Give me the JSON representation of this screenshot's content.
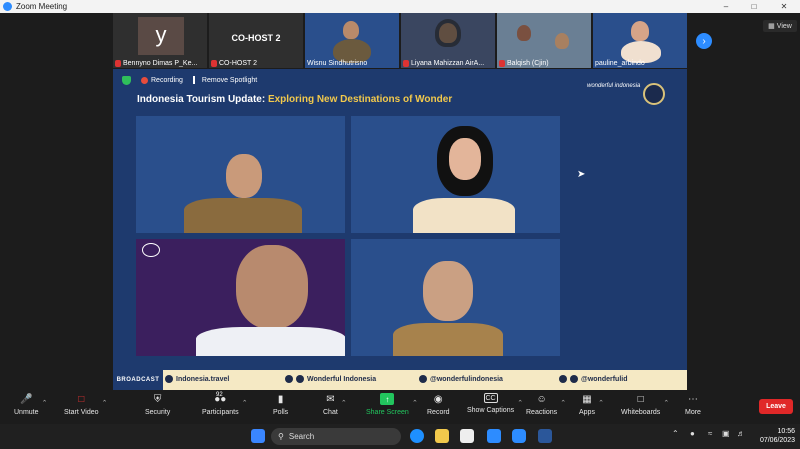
{
  "window": {
    "title": "Zoom Meeting"
  },
  "participants_strip": [
    {
      "name": "Bennyno Dimas P_Ke...",
      "avatar_letter": "y"
    },
    {
      "name": "CO-HOST 2",
      "tile_label": "CO-HOST 2"
    },
    {
      "name": "Wisnu Sindhutrisno"
    },
    {
      "name": "Liyana Mahizzan AirA..."
    },
    {
      "name": "Balqish (Cjin)"
    },
    {
      "name": "pauline_arbindo"
    }
  ],
  "view_button": "View",
  "stage": {
    "recording_label": "Recording",
    "remove_spotlight_label": "Remove Spotlight",
    "headline_prefix": "Indonesia Tourism Update: ",
    "headline_accent": "Exploring New Destinations of Wonder",
    "brand_text": "wonderful indonesia",
    "footer": {
      "broadcast": "BROADCAST",
      "website": "Indonesia.travel",
      "facebook": "Wonderful Indonesia",
      "instagram": "@wonderfulindonesia",
      "twitter_tiktok": "@wonderfulid"
    }
  },
  "toolbar": {
    "unmute": "Unmute",
    "start_video": "Start Video",
    "security": "Security",
    "participants": "Participants",
    "participants_count": "92",
    "polls": "Polls",
    "chat": "Chat",
    "share_screen": "Share Screen",
    "record": "Record",
    "show_captions": "Show Captions",
    "reactions": "Reactions",
    "apps": "Apps",
    "whiteboards": "Whiteboards",
    "more": "More",
    "leave": "Leave"
  },
  "taskbar": {
    "search_placeholder": "Search",
    "time": "10:56",
    "date": "07/06/2023"
  },
  "colors": {
    "stage_bg": "#1e3a6e",
    "accent_yellow": "#f2c94c",
    "leave_red": "#e02828",
    "share_green": "#22c55e",
    "zoom_blue": "#2d8cff"
  }
}
